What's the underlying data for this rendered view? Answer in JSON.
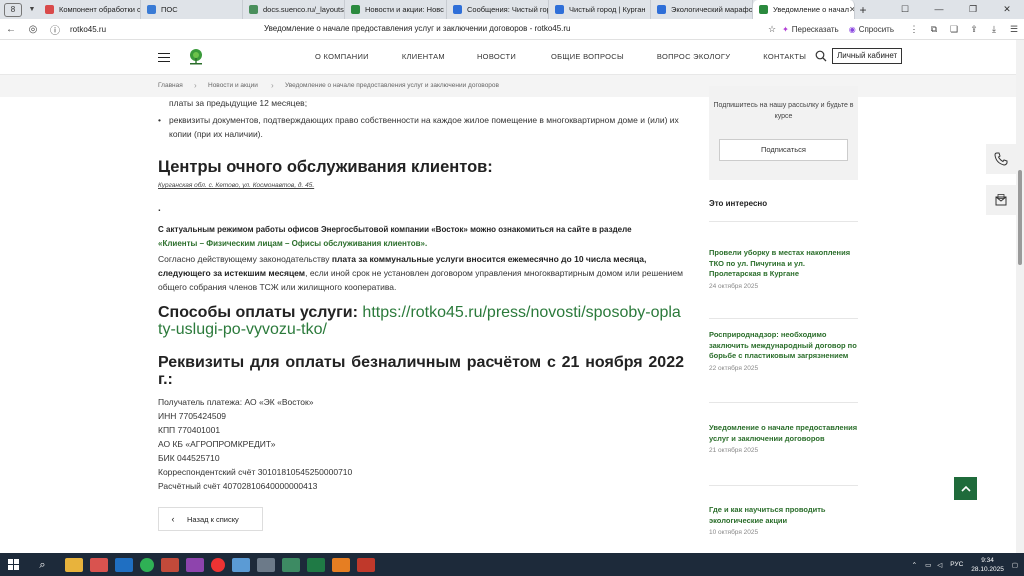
{
  "browser": {
    "tab_count": "8",
    "tabs": [
      {
        "title": "Компонент обработки с",
        "color": "#d94a4a"
      },
      {
        "title": "ПОС",
        "color": "#3a7bd5"
      },
      {
        "title": "docs.suenco.ru/_layouts/",
        "color": "#4a8f5c"
      },
      {
        "title": "Новости и акции: Новс",
        "color": "#2b8a3e"
      },
      {
        "title": "Сообщения: Чистый гор",
        "color": "#2f6fd8"
      },
      {
        "title": "Чистый город | Курган",
        "color": "#2f6fd8"
      },
      {
        "title": "Экологический марафо",
        "color": "#2f6fd8"
      },
      {
        "title": "Уведомление о начал",
        "color": "#2b8a3e"
      }
    ],
    "url": "rotko45.ru",
    "page_title": "Уведомление о начале предоставления услуг и заключении договоров - rotko45.ru",
    "retell_label": "Пересказать",
    "ask_label": "Спросить"
  },
  "header": {
    "menu": [
      "О КОМПАНИИ",
      "КЛИЕНТАМ",
      "НОВОСТИ",
      "ОБЩИЕ ВОПРОСЫ",
      "ВОПРОС ЭКОЛОГУ",
      "КОНТАКТЫ"
    ],
    "cabinet_label": "Личный кабинет"
  },
  "breadcrumb": {
    "items": [
      "Главная",
      "Новости и акции",
      "Уведомление о начале предоставления услуг и заключении договоров"
    ]
  },
  "main": {
    "bullet1_tail": "платы за предыдущие 12 месяцев;",
    "bullet2": "реквизиты документов, подтверждающих право собственности на каждое жилое помещение в многоквартирном доме и (или) их копии (при их наличии).",
    "centers_heading": "Центры очного обслуживания клиентов:",
    "centers_address": "Курганская обл. с. Кетово, ул. Космонавтов, д. 45.",
    "dot": ".",
    "offices_text_1": "С актуальным режимом работы офисов Энергосбытовой компании «Восток» можно ознакомиться на сайте в разделе",
    "offices_link": "«Клиенты – Физическим лицам – Офисы обслуживания клиентов».",
    "law_1": "Согласно действующему законодательству ",
    "law_bold": "плата за коммунальные услуги вносится ежемесячно до 10 числа месяца, следующего за истекшим месяцем",
    "law_2": ", если иной срок не установлен договором управления многоквартирным домом или решением общего собрания членов ТСЖ или жилищного кооператива.",
    "payment_heading": "Способы оплаты услуги: ",
    "payment_link": "https://rotko45.ru/press/novosti/sposoby-oplaty-uslugi-po-vyvozu-tko/",
    "requisites_heading": "Реквизиты для оплаты безналичным расчётом с 21 ноября 2022 г.:",
    "requisites": [
      "Получатель платежа: АО «ЭК «Восток»",
      "ИНН 7705424509",
      "КПП 770401001",
      "АО КБ «АГРОПРОМКРЕДИТ»",
      "БИК 044525710",
      "Корреспондентский счёт 30101810545250000710",
      "Расчётный счёт 40702810640000000413"
    ],
    "back_label": "Назад к списку"
  },
  "sidebar": {
    "subscribe_text": "Подпишитесь на нашу рассылку и будьте в курсе",
    "subscribe_button": "Подписаться",
    "interest_heading": "Это интересно",
    "news": [
      {
        "title": "Провели уборку в местах накопления ТКО по ул. Пичугина и ул. Пролетарская в Кургане",
        "date": "24 октября 2025"
      },
      {
        "title": "Росприроднадзор: необходимо заключить международный договор по борьбе с пластиковым загрязнением",
        "date": "22 октября 2025"
      },
      {
        "title": "Уведомление о начале предоставления услуг и заключении договоров",
        "date": "21 октября 2025"
      },
      {
        "title": "Где и как научиться проводить экологические акции",
        "date": "10 октября 2025"
      }
    ]
  },
  "taskbar": {
    "lang": "РУС",
    "time": "9:34",
    "date": "28.10.2025"
  },
  "colors": {
    "brand_green": "#2b6e2b",
    "up_button": "#1f6b3b",
    "taskbar": "#1d2a3a"
  }
}
